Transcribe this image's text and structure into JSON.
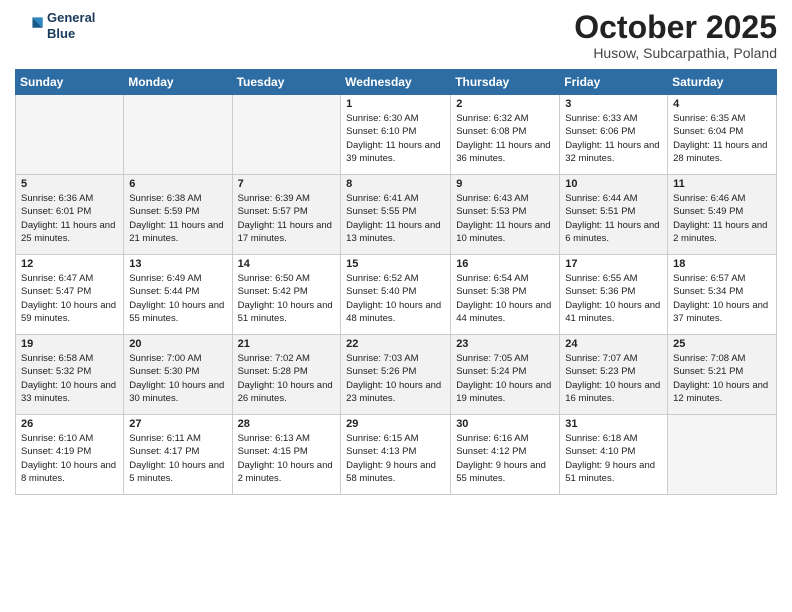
{
  "header": {
    "logo_line1": "General",
    "logo_line2": "Blue",
    "month": "October 2025",
    "location": "Husow, Subcarpathia, Poland"
  },
  "days_of_week": [
    "Sunday",
    "Monday",
    "Tuesday",
    "Wednesday",
    "Thursday",
    "Friday",
    "Saturday"
  ],
  "weeks": [
    [
      {
        "day": "",
        "info": ""
      },
      {
        "day": "",
        "info": ""
      },
      {
        "day": "",
        "info": ""
      },
      {
        "day": "1",
        "info": "Sunrise: 6:30 AM\nSunset: 6:10 PM\nDaylight: 11 hours\nand 39 minutes."
      },
      {
        "day": "2",
        "info": "Sunrise: 6:32 AM\nSunset: 6:08 PM\nDaylight: 11 hours\nand 36 minutes."
      },
      {
        "day": "3",
        "info": "Sunrise: 6:33 AM\nSunset: 6:06 PM\nDaylight: 11 hours\nand 32 minutes."
      },
      {
        "day": "4",
        "info": "Sunrise: 6:35 AM\nSunset: 6:04 PM\nDaylight: 11 hours\nand 28 minutes."
      }
    ],
    [
      {
        "day": "5",
        "info": "Sunrise: 6:36 AM\nSunset: 6:01 PM\nDaylight: 11 hours\nand 25 minutes."
      },
      {
        "day": "6",
        "info": "Sunrise: 6:38 AM\nSunset: 5:59 PM\nDaylight: 11 hours\nand 21 minutes."
      },
      {
        "day": "7",
        "info": "Sunrise: 6:39 AM\nSunset: 5:57 PM\nDaylight: 11 hours\nand 17 minutes."
      },
      {
        "day": "8",
        "info": "Sunrise: 6:41 AM\nSunset: 5:55 PM\nDaylight: 11 hours\nand 13 minutes."
      },
      {
        "day": "9",
        "info": "Sunrise: 6:43 AM\nSunset: 5:53 PM\nDaylight: 11 hours\nand 10 minutes."
      },
      {
        "day": "10",
        "info": "Sunrise: 6:44 AM\nSunset: 5:51 PM\nDaylight: 11 hours\nand 6 minutes."
      },
      {
        "day": "11",
        "info": "Sunrise: 6:46 AM\nSunset: 5:49 PM\nDaylight: 11 hours\nand 2 minutes."
      }
    ],
    [
      {
        "day": "12",
        "info": "Sunrise: 6:47 AM\nSunset: 5:47 PM\nDaylight: 10 hours\nand 59 minutes."
      },
      {
        "day": "13",
        "info": "Sunrise: 6:49 AM\nSunset: 5:44 PM\nDaylight: 10 hours\nand 55 minutes."
      },
      {
        "day": "14",
        "info": "Sunrise: 6:50 AM\nSunset: 5:42 PM\nDaylight: 10 hours\nand 51 minutes."
      },
      {
        "day": "15",
        "info": "Sunrise: 6:52 AM\nSunset: 5:40 PM\nDaylight: 10 hours\nand 48 minutes."
      },
      {
        "day": "16",
        "info": "Sunrise: 6:54 AM\nSunset: 5:38 PM\nDaylight: 10 hours\nand 44 minutes."
      },
      {
        "day": "17",
        "info": "Sunrise: 6:55 AM\nSunset: 5:36 PM\nDaylight: 10 hours\nand 41 minutes."
      },
      {
        "day": "18",
        "info": "Sunrise: 6:57 AM\nSunset: 5:34 PM\nDaylight: 10 hours\nand 37 minutes."
      }
    ],
    [
      {
        "day": "19",
        "info": "Sunrise: 6:58 AM\nSunset: 5:32 PM\nDaylight: 10 hours\nand 33 minutes."
      },
      {
        "day": "20",
        "info": "Sunrise: 7:00 AM\nSunset: 5:30 PM\nDaylight: 10 hours\nand 30 minutes."
      },
      {
        "day": "21",
        "info": "Sunrise: 7:02 AM\nSunset: 5:28 PM\nDaylight: 10 hours\nand 26 minutes."
      },
      {
        "day": "22",
        "info": "Sunrise: 7:03 AM\nSunset: 5:26 PM\nDaylight: 10 hours\nand 23 minutes."
      },
      {
        "day": "23",
        "info": "Sunrise: 7:05 AM\nSunset: 5:24 PM\nDaylight: 10 hours\nand 19 minutes."
      },
      {
        "day": "24",
        "info": "Sunrise: 7:07 AM\nSunset: 5:23 PM\nDaylight: 10 hours\nand 16 minutes."
      },
      {
        "day": "25",
        "info": "Sunrise: 7:08 AM\nSunset: 5:21 PM\nDaylight: 10 hours\nand 12 minutes."
      }
    ],
    [
      {
        "day": "26",
        "info": "Sunrise: 6:10 AM\nSunset: 4:19 PM\nDaylight: 10 hours\nand 8 minutes."
      },
      {
        "day": "27",
        "info": "Sunrise: 6:11 AM\nSunset: 4:17 PM\nDaylight: 10 hours\nand 5 minutes."
      },
      {
        "day": "28",
        "info": "Sunrise: 6:13 AM\nSunset: 4:15 PM\nDaylight: 10 hours\nand 2 minutes."
      },
      {
        "day": "29",
        "info": "Sunrise: 6:15 AM\nSunset: 4:13 PM\nDaylight: 9 hours\nand 58 minutes."
      },
      {
        "day": "30",
        "info": "Sunrise: 6:16 AM\nSunset: 4:12 PM\nDaylight: 9 hours\nand 55 minutes."
      },
      {
        "day": "31",
        "info": "Sunrise: 6:18 AM\nSunset: 4:10 PM\nDaylight: 9 hours\nand 51 minutes."
      },
      {
        "day": "",
        "info": ""
      }
    ]
  ]
}
